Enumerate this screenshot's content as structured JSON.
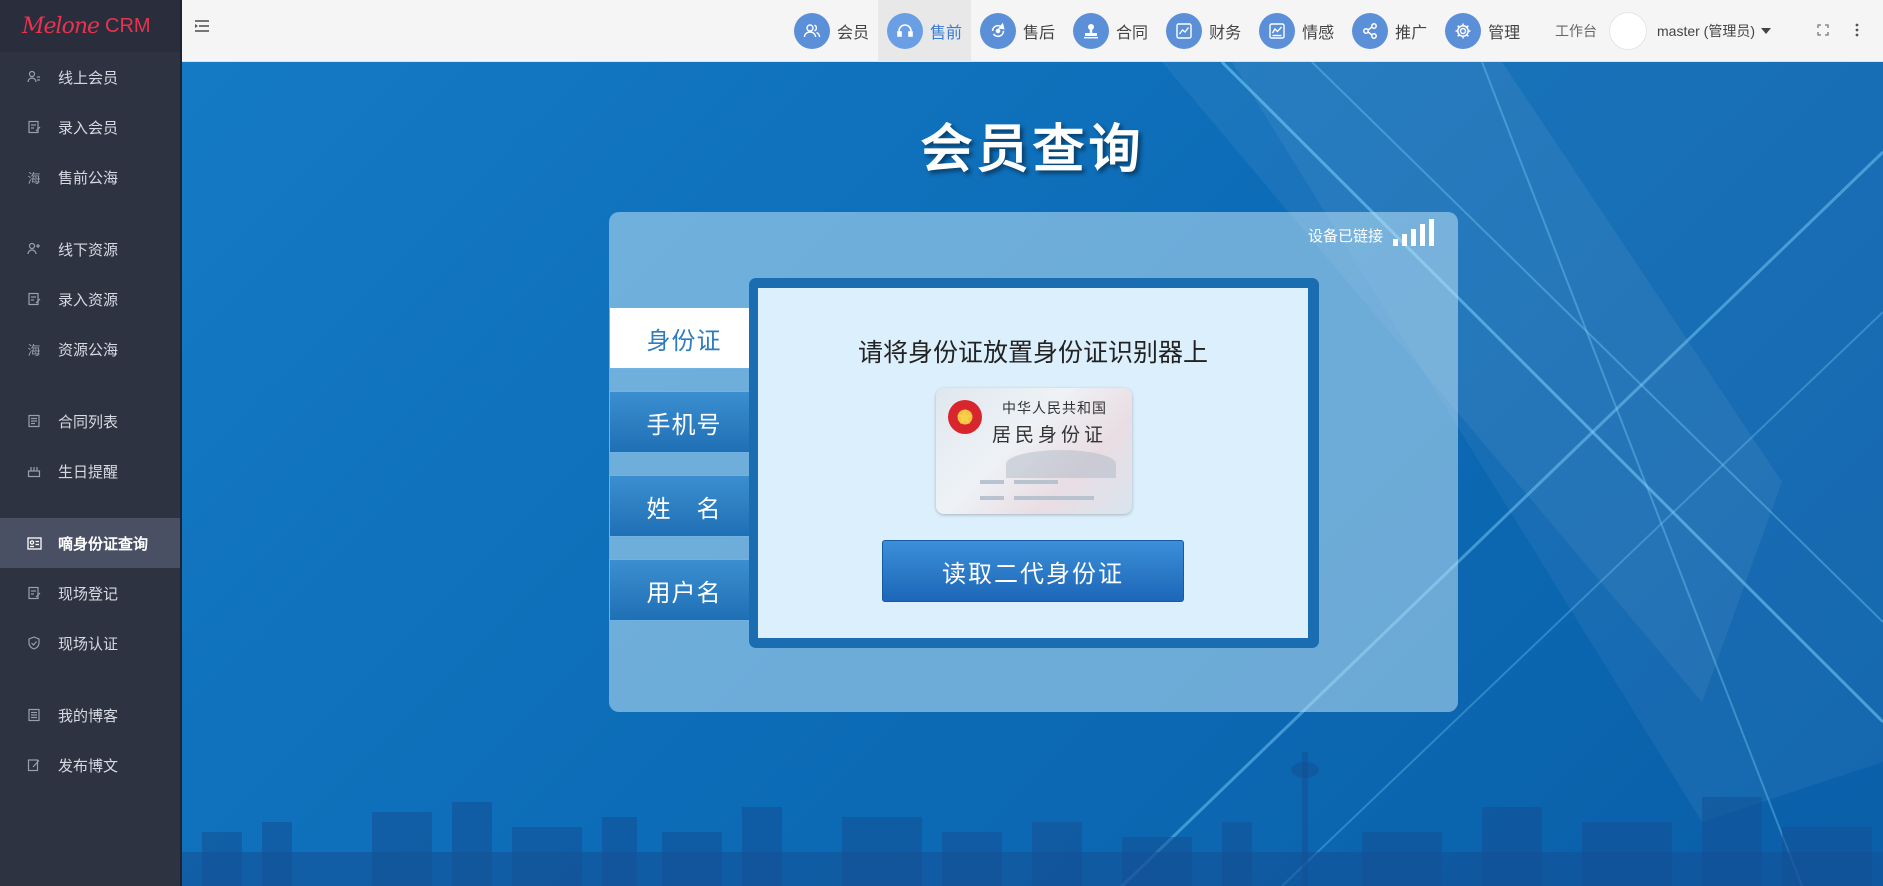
{
  "logo": {
    "script": "Melone",
    "suffix": "CRM"
  },
  "sidebar": {
    "groups": [
      [
        {
          "label": "线上会员",
          "icon": "user-list-icon"
        },
        {
          "label": "录入会员",
          "icon": "edit-doc-icon"
        },
        {
          "label": "售前公海",
          "icon": "sea-char-icon",
          "glyph": "海"
        }
      ],
      [
        {
          "label": "线下资源",
          "icon": "user-plus-icon"
        },
        {
          "label": "录入资源",
          "icon": "edit-doc-icon"
        },
        {
          "label": "资源公海",
          "icon": "sea-char-icon",
          "glyph": "海"
        }
      ],
      [
        {
          "label": "合同列表",
          "icon": "contract-icon"
        },
        {
          "label": "生日提醒",
          "icon": "cake-icon"
        }
      ],
      [
        {
          "label": "嘀身份证查询",
          "icon": "id-card-icon",
          "active": true
        },
        {
          "label": "现场登记",
          "icon": "edit-doc-icon"
        },
        {
          "label": "现场认证",
          "icon": "shield-check-icon"
        }
      ],
      [
        {
          "label": "我的博客",
          "icon": "blog-icon"
        },
        {
          "label": "发布博文",
          "icon": "compose-icon"
        }
      ]
    ]
  },
  "topnav": {
    "items": [
      {
        "label": "会员",
        "icon": "members-icon"
      },
      {
        "label": "售前",
        "icon": "headset-icon",
        "active": true
      },
      {
        "label": "售后",
        "icon": "refresh-headset-icon"
      },
      {
        "label": "合同",
        "icon": "stamp-icon"
      },
      {
        "label": "财务",
        "icon": "finance-chart-icon"
      },
      {
        "label": "情感",
        "icon": "emotion-chart-icon"
      },
      {
        "label": "推广",
        "icon": "share-icon"
      },
      {
        "label": "管理",
        "icon": "gear-icon"
      }
    ],
    "workbench": "工作台",
    "user": "master (管理员)"
  },
  "main": {
    "title": "会员查询",
    "device_status": "设备已链接",
    "tabs": [
      "身份证",
      "手机号",
      "姓　名",
      "用户名"
    ],
    "active_tab": 0,
    "hint": "请将身份证放置身份证识别器上",
    "idcard": {
      "line1": "中华人民共和国",
      "line2": "居民身份证"
    },
    "read_button": "读取二代身份证"
  },
  "colors": {
    "accent": "#3a7bd5",
    "sidebar_bg": "#2e3342",
    "brand": "#e8334e"
  }
}
